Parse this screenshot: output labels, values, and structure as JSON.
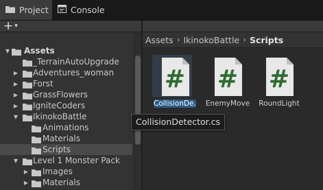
{
  "tabs": [
    {
      "label": "Project",
      "icon": "folder-icon",
      "active": true
    },
    {
      "label": "Console",
      "icon": "console-icon",
      "active": false
    }
  ],
  "toolbar": {
    "create_label": "+",
    "create_icon": "plus-icon"
  },
  "tree": [
    {
      "label": "Assets",
      "expanded": true,
      "bold": true
    },
    {
      "label": "_TerrainAutoUpgrade",
      "has_children": false
    },
    {
      "label": "Adventures_woman",
      "has_children": true
    },
    {
      "label": "Forst",
      "has_children": true
    },
    {
      "label": "GrassFlowers",
      "has_children": true
    },
    {
      "label": "IgniteCoders",
      "has_children": true
    },
    {
      "label": "IkinokoBattle",
      "expanded": true
    },
    {
      "label": "Animations",
      "has_children": false
    },
    {
      "label": "Materials",
      "has_children": false
    },
    {
      "label": "Scripts",
      "selected": true
    },
    {
      "label": "Level 1 Monster Pack",
      "expanded": true
    },
    {
      "label": "Images",
      "has_children": true
    },
    {
      "label": "Materials",
      "has_children": true
    }
  ],
  "breadcrumb": [
    "Assets",
    "IkinokoBattle",
    "Scripts"
  ],
  "assets": [
    {
      "name": "CollisionDe...",
      "selected": true
    },
    {
      "name": "EnemyMove",
      "selected": false
    },
    {
      "name": "RoundLight",
      "selected": false
    }
  ],
  "tooltip": "CollisionDetector.cs",
  "colors": {
    "folder": "#c8c8c8",
    "script_page": "#e8e8e8",
    "hash": "#2e6b2e",
    "selection": "#2c5d87",
    "tab_active": "#3c3c3c"
  }
}
